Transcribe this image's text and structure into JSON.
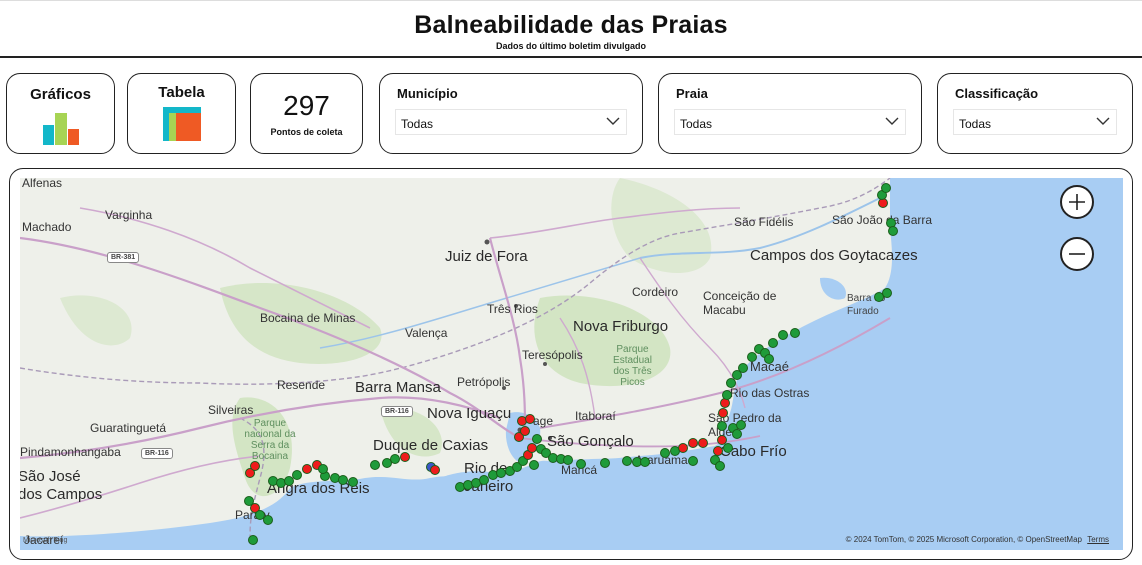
{
  "header": {
    "title": "Balneabilidade das Praias",
    "subtitle": "Dados do último boletim divulgado"
  },
  "nav": {
    "graficos_label": "Gráficos",
    "tabela_label": "Tabela"
  },
  "kpi": {
    "value": "297",
    "caption": "Pontos de coleta"
  },
  "slicers": {
    "municipio": {
      "label": "Município",
      "selected": "Todas"
    },
    "praia": {
      "label": "Praia",
      "selected": "Todas"
    },
    "classificacao": {
      "label": "Classificação",
      "selected": "Todas"
    }
  },
  "map": {
    "labels": {
      "alfenas": "Alfenas",
      "varginha": "Varginha",
      "machado": "Machado",
      "juiz_de_fora": "Juiz de Fora",
      "sao_fidelis": "São Fidélis",
      "sao_joao_da_barra": "São João da Barra",
      "campos": "Campos dos Goytacazes",
      "cordeiro": "Cordeiro",
      "conceicao_de_macabu": "Conceição de Macabu",
      "barra_do_furado": "Barra do Furado",
      "bocaina_de_minas": "Bocaina de Minas",
      "valenca": "Valença",
      "tres_rios": "Três Rios",
      "nova_friburgo": "Nova Friburgo",
      "teresopolis": "Teresópolis",
      "parque_tres_picos": "Parque Estadual dos Três Picos",
      "macae": "Macaé",
      "rio_das_ostras": "Rio das Ostras",
      "resende": "Resende",
      "barra_mansa": "Barra Mansa",
      "petropolis": "Petrópolis",
      "silveiras": "Silveiras",
      "nova_iguacu": "Nova Iguaçu",
      "itaborai": "Itaboraí",
      "sao_pedro_da_aldeia": "São Pedro da Aldeia",
      "guaratingueta": "Guaratinguetá",
      "pindamonhangaba": "Pindamonhangaba",
      "parque_bocaina": "Parque nacional da Serra da Bocaina",
      "duque_de_caxias": "Duque de Caxias",
      "sao_goncalo": "São Gonçalo",
      "cabo_frio": "Cabo Frío",
      "sao_jose_dos_campos": "São José dos Campos",
      "angra": "Angra dos Reis",
      "rio_de_janeiro": "Rio de Janeiro",
      "marica": "Maricá",
      "araruama": "Araruama",
      "paraty": "Paraty",
      "jacarei": "Jacareí",
      "niteroi_partial": "age"
    },
    "shields": {
      "br381": "BR-381",
      "br116a": "BR-116",
      "br116b": "BR-116"
    },
    "attribution": "© 2024 TomTom, © 2025 Microsoft Corporation, © OpenStreetMap",
    "terms": "Terms",
    "bing_label": "Microsoft Bing",
    "colors": {
      "land": "#eef0ea",
      "water": "#a8cdf3",
      "green_area": "#d6e6c8",
      "good": "#1f9b3a",
      "bad": "#ee1c1c"
    },
    "zoom_in": "zoom-in",
    "zoom_out": "zoom-out"
  }
}
